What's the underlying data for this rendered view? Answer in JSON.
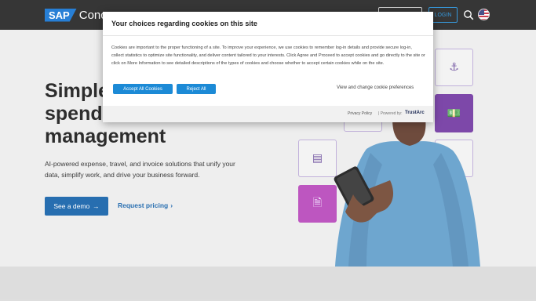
{
  "header": {
    "logo_sap": "SAP",
    "logo_product": "Concur",
    "login_label": "LOGIN",
    "icons": [
      "search-icon",
      "us-flag-icon"
    ]
  },
  "hero": {
    "headline_line1": "Simple",
    "headline_line2": "spend",
    "headline_line3": "management",
    "subcopy": "AI-powered expense, travel, and invoice solutions that unify your data, simplify work, and drive your business forward.",
    "demo_button": "See a demo",
    "pricing_link": "Request pricing"
  },
  "cookie_modal": {
    "title": "Your choices regarding cookies on this site",
    "body": "Cookies are important to the proper functioning of a site. To improve your experience, we use cookies to remember log-in details and provide secure log-in, collect statistics to optimize site functionality, and deliver content tailored to your interests. Click Agree and Proceed to accept cookies and go directly to the site or click on More Information to see detailed descriptions of the types of cookies and choose whether to accept certain cookies while on the site.",
    "accept_label": "Accept All Cookies",
    "reject_label": "Reject All",
    "preferences_label": "View and change cookie preferences",
    "privacy_label": "Privacy Policy",
    "powered_label": "| Powered by:",
    "trustarc_brand": "TrustArc"
  },
  "colors": {
    "header_bg": "#1b1b1b",
    "brand_blue": "#0a5aa6",
    "accept_blue": "#1c8ad6",
    "tile_purple": "#6c2f9e",
    "tile_pink": "#b43fb8"
  }
}
